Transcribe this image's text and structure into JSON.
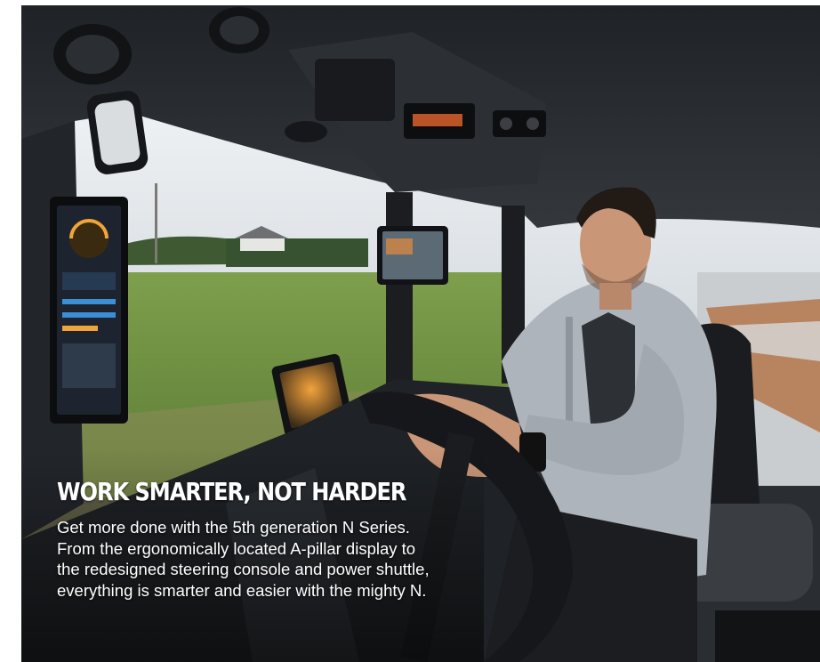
{
  "article": {
    "headline": "WORK SMARTER, NOT HARDER",
    "body": "Get more done with the 5th generation N Series. From the ergonomically located A-pillar display to the redesigned steering console and power shuttle, everything is smarter and easier with the mighty N."
  },
  "colors": {
    "cab_interior": "#2a2d31",
    "sky": "#dfe4e8",
    "field": "#6d8f3f",
    "fleece": "#aeb4bb",
    "text": "#ffffff"
  }
}
